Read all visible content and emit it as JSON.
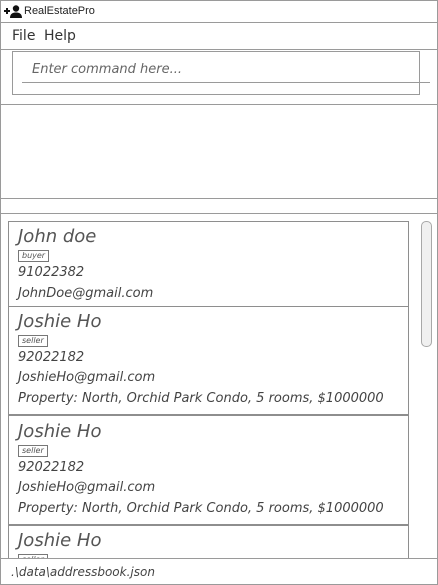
{
  "window": {
    "title": "RealEstatePro",
    "icon": "add-person-icon"
  },
  "menu": {
    "items": [
      "File",
      "Help"
    ]
  },
  "command": {
    "placeholder": "Enter command here...",
    "value": ""
  },
  "result": {
    "text": ""
  },
  "persons": [
    {
      "name": "John doe",
      "tag": "buyer",
      "phone": "91022382",
      "email": "JohnDoe@gmail.com",
      "property": ""
    },
    {
      "name": "Joshie Ho",
      "tag": "seller",
      "phone": "92022182",
      "email": "JoshieHo@gmail.com",
      "property": "Property: North, Orchid Park Condo, 5 rooms, $1000000"
    },
    {
      "name": "Joshie Ho",
      "tag": "seller",
      "phone": "92022182",
      "email": "JoshieHo@gmail.com",
      "property": "Property: North, Orchid Park Condo, 5 rooms, $1000000"
    },
    {
      "name": "Joshie Ho",
      "tag": "seller",
      "phone": "",
      "email": "",
      "property": ""
    }
  ],
  "status": {
    "path": ".\\data\\addressbook.json"
  }
}
